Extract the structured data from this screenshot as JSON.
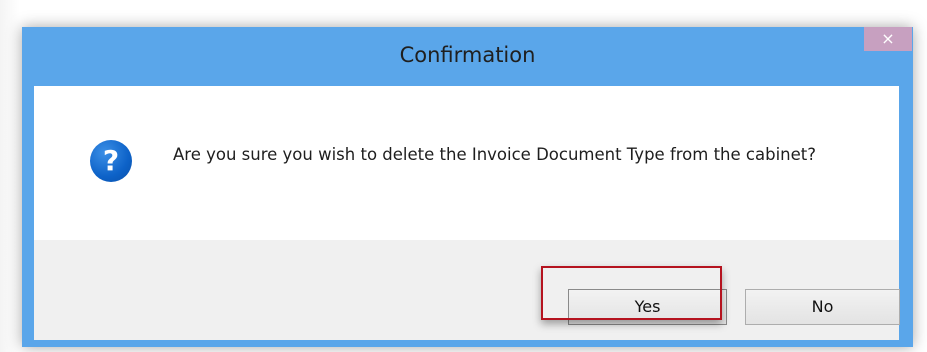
{
  "dialog": {
    "title": "Confirmation",
    "close_label": "×",
    "message": "Are you sure you wish to delete the Invoice Document Type from the cabinet?",
    "icon": "question-icon",
    "icon_glyph": "?",
    "buttons": {
      "yes_label": "Yes",
      "no_label": "No"
    }
  },
  "colors": {
    "titlebar": "#5aa6ea",
    "close_button": "#c7a0c0",
    "icon": "#0d62c8",
    "highlight_border": "#b5131f",
    "footer": "#f0f0f0"
  }
}
